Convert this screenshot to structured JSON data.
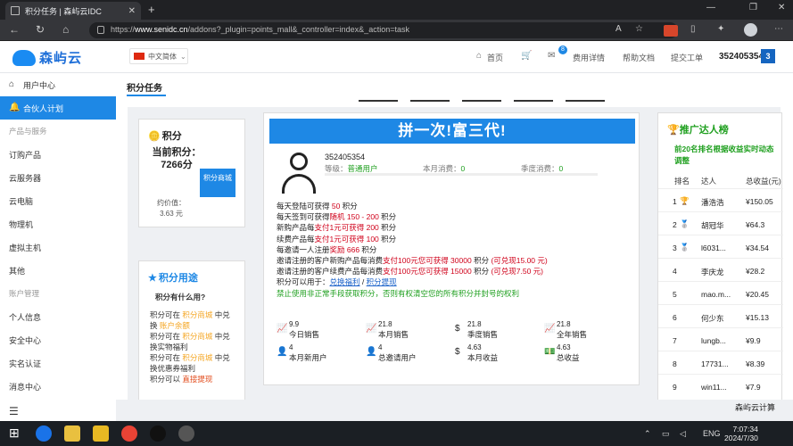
{
  "browser": {
    "tab_title": "积分任务 | 森屿云IDC",
    "url_host": "www.senidc.cn",
    "url_path": "/addons?_plugin=points_mall&_controller=index&_action=task"
  },
  "header": {
    "logo_text": "森屿云",
    "language": "中文简体",
    "nav": [
      "首页",
      "费用详情",
      "帮助文档",
      "提交工单"
    ],
    "message_count": "8",
    "user_id": "352405354",
    "user_level_badge": "3"
  },
  "sidebar": {
    "items": [
      {
        "label": "用户中心",
        "type": "item",
        "icon": "home-icon"
      },
      {
        "label": "合伙人计划",
        "type": "active",
        "icon": "bell-icon"
      },
      {
        "label": "产品与服务",
        "type": "group"
      },
      {
        "label": "订购产品",
        "type": "item"
      },
      {
        "label": "云服务器",
        "type": "item"
      },
      {
        "label": "云电脑",
        "type": "item"
      },
      {
        "label": "物理机",
        "type": "item"
      },
      {
        "label": "虚拟主机",
        "type": "item"
      },
      {
        "label": "其他",
        "type": "item"
      },
      {
        "label": "账户管理",
        "type": "group"
      },
      {
        "label": "个人信息",
        "type": "item"
      },
      {
        "label": "安全中心",
        "type": "item"
      },
      {
        "label": "实名认证",
        "type": "item"
      },
      {
        "label": "消息中心",
        "type": "item"
      }
    ]
  },
  "page": {
    "title": "积分任务"
  },
  "points_card": {
    "title": "积分",
    "current_label": "当前积分：",
    "current_value": "7266分",
    "mall_button": "积分商城",
    "approx_label": "约价值：",
    "approx_value": "3.63 元"
  },
  "usage_card": {
    "title": "积分用途",
    "question": "积分有什么用?",
    "lines": [
      {
        "pre": "积分可在 ",
        "hl": "积分商城",
        "post": " 中兑换 ",
        "hl2": "账户余额"
      },
      {
        "pre": "积分可在 ",
        "hl": "积分商城",
        "post": " 中兑换实物福利",
        "hl2": ""
      },
      {
        "pre": "积分可在 ",
        "hl": "积分商城",
        "post": " 中兑换优惠券福利",
        "hl2": ""
      },
      {
        "pre": "积分可以 ",
        "hl": "直接提现",
        "post": "",
        "hl2": ""
      }
    ]
  },
  "task_card": {
    "banner": "拼一次!富三代!",
    "user_id": "352405354",
    "level_label": "等级：",
    "level_value": "普通用户",
    "month_label": "本月消费：",
    "month_value": "0",
    "quarter_label": "季度消费：",
    "quarter_value": "0",
    "rules": [
      [
        "每天登陆可获得 ",
        "50",
        " 积分"
      ],
      [
        "每天签到可获得",
        "随机 150 - 200",
        " 积分"
      ],
      [
        "新购产品每",
        "支付1元可获得 200",
        " 积分"
      ],
      [
        "续费产品每",
        "支付1元可获得 100",
        " 积分"
      ],
      [
        "每邀请一人注册",
        "奖励 666",
        " 积分"
      ],
      [
        "邀请注册的客户新购产品每消费",
        "支付100元您可获得 30000",
        " 积分 ",
        "(可兑现15.00 元)"
      ],
      [
        "邀请注册的客户续费产品每消费",
        "支付100元您可获得 15000",
        " 积分 ",
        "(可兑现7.50 元)"
      ]
    ],
    "usable_label": "积分可以用于：",
    "usable_link1": "兑换福利",
    "usable_link2": "积分提现",
    "warning": "禁止使用非正常手段获取积分，否则有权清空您的所有积分并封号的权利",
    "stats": [
      {
        "value": "9.9",
        "label": "今日销售",
        "icon": "chart-icon"
      },
      {
        "value": "21.8",
        "label": "本月销售",
        "icon": "chart-icon"
      },
      {
        "value": "21.8",
        "label": "季度销售",
        "icon": "dollar-icon"
      },
      {
        "value": "21.8",
        "label": "全年销售",
        "icon": "chart-icon"
      },
      {
        "value": "4",
        "label": "本月新用户",
        "icon": "user-plus-icon"
      },
      {
        "value": "4",
        "label": "总邀请用户",
        "icon": "user-plus-icon"
      },
      {
        "value": "4.63",
        "label": "本月收益",
        "icon": "dollar-icon"
      },
      {
        "value": "4.63",
        "label": "总收益",
        "icon": "money-icon"
      }
    ]
  },
  "ranking": {
    "title": "推广达人榜",
    "subtitle": "前20名排名根据收益实时动态调整",
    "headers": [
      "排名",
      "达人",
      "总收益(元)"
    ],
    "rows": [
      {
        "rank": "1",
        "name": "潘浩浩",
        "amount": "¥150.05",
        "icon": "trophy-icon"
      },
      {
        "rank": "2",
        "name": "胡冠华",
        "amount": "¥64.3",
        "icon": "medal-icon"
      },
      {
        "rank": "3",
        "name": "l6031...",
        "amount": "¥34.54",
        "icon": "medal-icon"
      },
      {
        "rank": "4",
        "name": "李庆龙",
        "amount": "¥28.2",
        "icon": ""
      },
      {
        "rank": "5",
        "name": "mao.m...",
        "amount": "¥20.45",
        "icon": ""
      },
      {
        "rank": "6",
        "name": "何少东",
        "amount": "¥15.13",
        "icon": ""
      },
      {
        "rank": "7",
        "name": "lungb...",
        "amount": "¥9.9",
        "icon": ""
      },
      {
        "rank": "8",
        "name": "17731...",
        "amount": "¥8.39",
        "icon": ""
      },
      {
        "rank": "9",
        "name": "win11...",
        "amount": "¥7.9",
        "icon": ""
      }
    ]
  },
  "footer": {
    "calc": "森屿云计算"
  },
  "taskbar": {
    "lang": "ENG",
    "time": "7:07:34",
    "date": "2024/7/30"
  }
}
